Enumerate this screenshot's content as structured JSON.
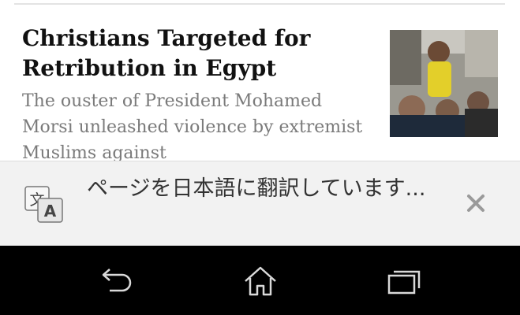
{
  "article": {
    "headline": "Christians Targeted for Retribution in Egypt",
    "summary": "The ouster of President Mohamed Morsi unleashed violence by extremist Muslims against",
    "thumbnail_icon": "news-photo"
  },
  "translate_bar": {
    "message": "ページを日本語に翻訳しています...",
    "icon": "translate-icon",
    "close_icon": "close-icon"
  },
  "navigation_bar": {
    "buttons": [
      "back-icon",
      "home-icon",
      "recents-icon"
    ]
  },
  "colors": {
    "headline": "#111111",
    "summary": "#7a7a7a",
    "translate_bar_bg": "#f2f2f2",
    "navbar_bg": "#000000",
    "nav_icon": "#d9d9d9"
  }
}
